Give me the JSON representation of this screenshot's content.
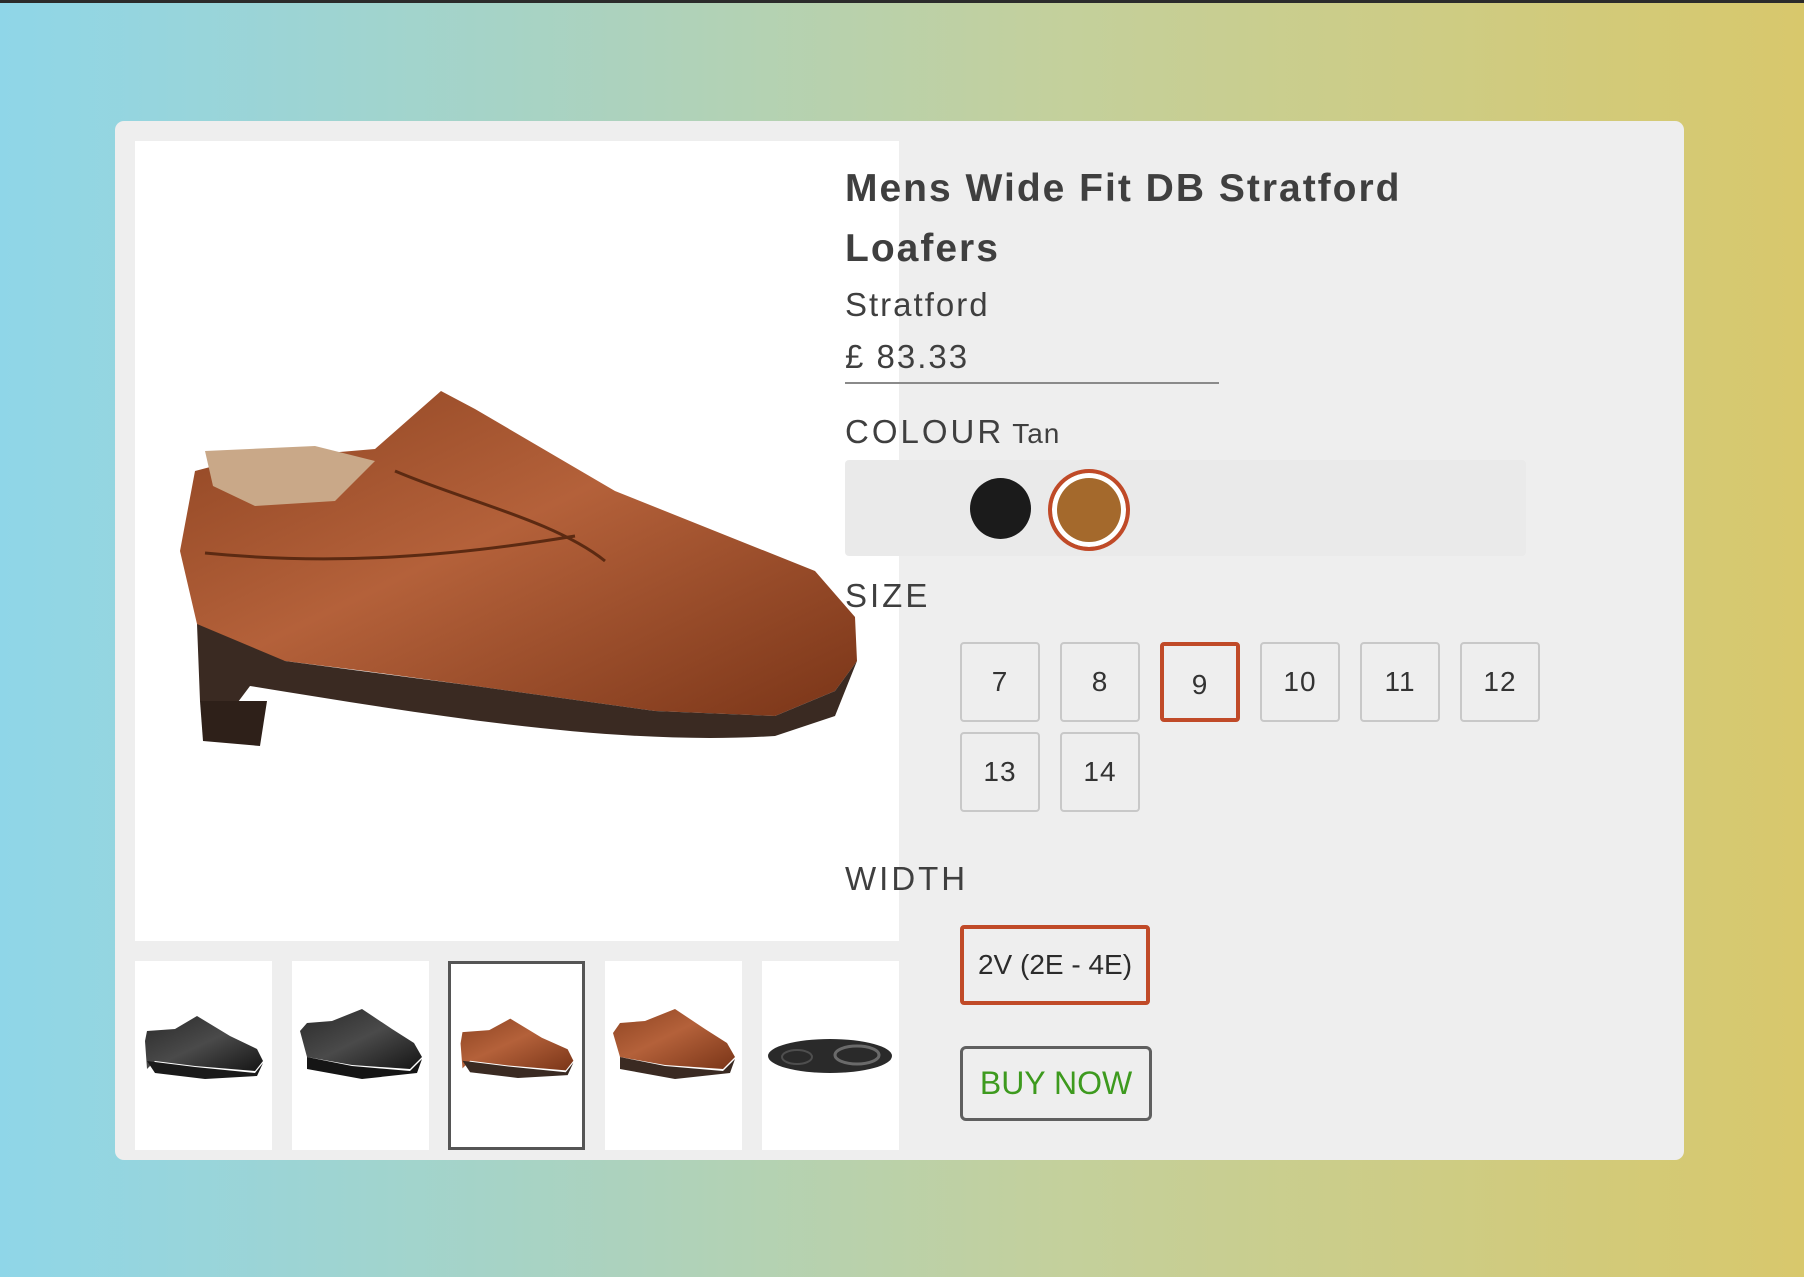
{
  "product": {
    "title": "Mens Wide Fit DB Stratford Loafers",
    "brand": "Stratford",
    "price": "£ 83.33"
  },
  "gallery": {
    "main_image": "tan-loafer-side-view",
    "thumbnails": [
      {
        "image": "black-loafer-side-view",
        "selected": false
      },
      {
        "image": "black-loafer-angled-view",
        "selected": false
      },
      {
        "image": "tan-loafer-side-view",
        "selected": true
      },
      {
        "image": "tan-loafer-angled-view",
        "selected": false
      },
      {
        "image": "loafer-sole-view",
        "selected": false
      }
    ]
  },
  "colour": {
    "label": "COLOUR",
    "selected": "Tan",
    "options": [
      {
        "name": "Black",
        "hex": "#1b1b1b"
      },
      {
        "name": "Tan",
        "hex": "#a4692c"
      }
    ]
  },
  "size": {
    "label": "SIZE",
    "options": [
      "7",
      "8",
      "9",
      "10",
      "11",
      "12",
      "13",
      "14"
    ],
    "selected": "9"
  },
  "width": {
    "label": "WIDTH",
    "selected": "2V (2E - 4E)"
  },
  "actions": {
    "buy_now": "BUY NOW"
  },
  "colors": {
    "accent": "#c04a28",
    "buy_text": "#3d9a1e",
    "card_background": "#eeeeee",
    "text": "#3f3f3f"
  }
}
